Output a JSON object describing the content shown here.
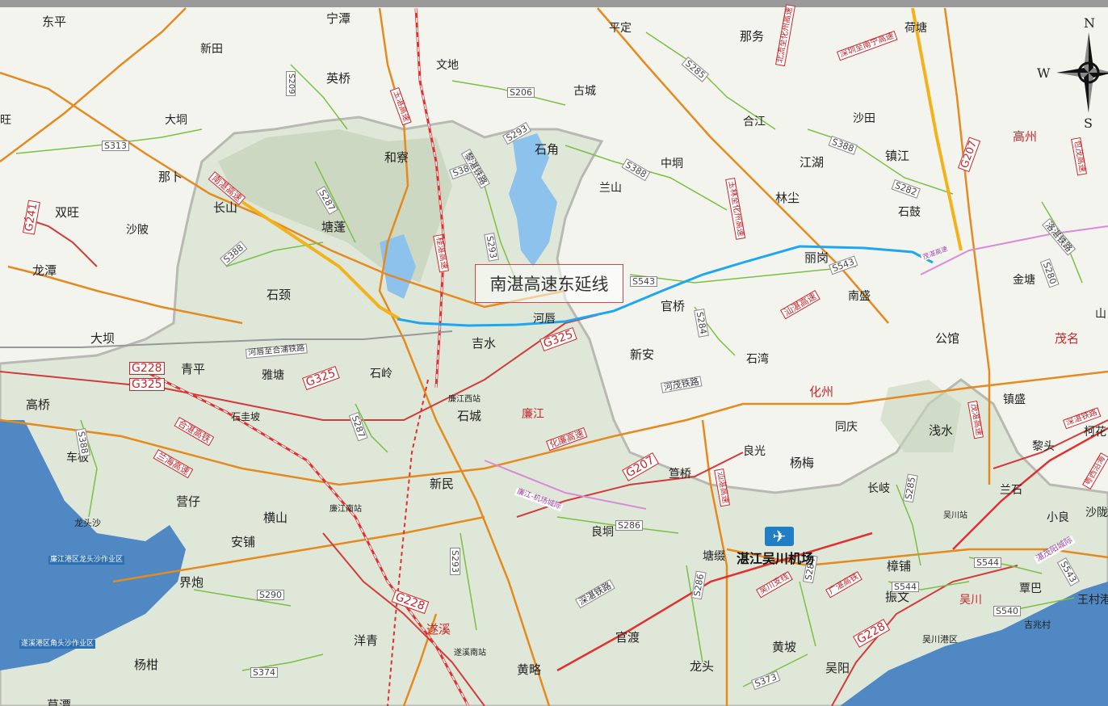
{
  "callout": "南湛高速东延线",
  "airport": {
    "name": "湛江吴川机场",
    "icon": "airplane-icon"
  },
  "compass": {
    "n": "N",
    "w": "W",
    "s": "S"
  },
  "colors": {
    "highway": "#e48a1e",
    "national_road": "#d23b3b",
    "provincial_road": "#7ac043",
    "railway": "#e03030",
    "extension_line": "#1ea6ee",
    "water": "#8cc2ec",
    "land": "#f4f4ef",
    "terrain": "#dfe7d8"
  },
  "places": [
    {
      "id": "dongping",
      "name": "东平"
    },
    {
      "id": "ningtan",
      "name": "宁潭"
    },
    {
      "id": "pingding",
      "name": "平定"
    },
    {
      "id": "nawu",
      "name": "那务"
    },
    {
      "id": "hetang",
      "name": "荷塘"
    },
    {
      "id": "xintian",
      "name": "新田"
    },
    {
      "id": "wendi",
      "name": "文地"
    },
    {
      "id": "yingqiao",
      "name": "英桥"
    },
    {
      "id": "guchen",
      "name": "古城"
    },
    {
      "id": "wang",
      "name": "旺"
    },
    {
      "id": "dakeng",
      "name": "大垌"
    },
    {
      "id": "hehe",
      "name": "合江"
    },
    {
      "id": "shatian",
      "name": "沙田"
    },
    {
      "id": "gaozhou",
      "name": "高州"
    },
    {
      "id": "hezhai",
      "name": "和寮"
    },
    {
      "id": "shijiao",
      "name": "石角"
    },
    {
      "id": "nabu",
      "name": "那卜"
    },
    {
      "id": "zhongjiong",
      "name": "中垌"
    },
    {
      "id": "jianghu",
      "name": "江湖"
    },
    {
      "id": "zhenjiang",
      "name": "镇江"
    },
    {
      "id": "lanshan",
      "name": "兰山"
    },
    {
      "id": "changshan",
      "name": "长山"
    },
    {
      "id": "shuangwang",
      "name": "双旺"
    },
    {
      "id": "linchen",
      "name": "林尘"
    },
    {
      "id": "shigu",
      "name": "石鼓"
    },
    {
      "id": "tangpeng",
      "name": "塘蓬"
    },
    {
      "id": "shapo",
      "name": "沙陂"
    },
    {
      "id": "longtan",
      "name": "龙潭"
    },
    {
      "id": "ligang",
      "name": "丽岗"
    },
    {
      "id": "jintang",
      "name": "金塘"
    },
    {
      "id": "shixu",
      "name": "石颈"
    },
    {
      "id": "nansheng",
      "name": "南盛"
    },
    {
      "id": "guanqiao",
      "name": "官桥"
    },
    {
      "id": "hechun",
      "name": "河唇"
    },
    {
      "id": "shan",
      "name": "山"
    },
    {
      "id": "daba",
      "name": "大坝"
    },
    {
      "id": "jishui",
      "name": "吉水"
    },
    {
      "id": "gongguan",
      "name": "公馆"
    },
    {
      "id": "maoming",
      "name": "茂名"
    },
    {
      "id": "qingping",
      "name": "青平"
    },
    {
      "id": "xinan",
      "name": "新安"
    },
    {
      "id": "shiwan",
      "name": "石湾"
    },
    {
      "id": "huazhou",
      "name": "化州"
    },
    {
      "id": "yatang",
      "name": "雅塘"
    },
    {
      "id": "shiling",
      "name": "石岭"
    },
    {
      "id": "gaoqiao",
      "name": "高桥"
    },
    {
      "id": "lianjiangxi",
      "name": "廉江西站"
    },
    {
      "id": "shigupo",
      "name": "石圭坡"
    },
    {
      "id": "shicheng",
      "name": "石城"
    },
    {
      "id": "lianjiang",
      "name": "廉江"
    },
    {
      "id": "zhensheng",
      "name": "镇盛"
    },
    {
      "id": "tongqing",
      "name": "同庆"
    },
    {
      "id": "qianshui",
      "name": "浅水"
    },
    {
      "id": "kehua",
      "name": "柯花"
    },
    {
      "id": "cheban",
      "name": "车板"
    },
    {
      "id": "liangguang",
      "name": "良光"
    },
    {
      "id": "shentou",
      "name": "黎头"
    },
    {
      "id": "xinmin",
      "name": "新民"
    },
    {
      "id": "yangmei",
      "name": "杨梅"
    },
    {
      "id": "dongqiao",
      "name": "笪桥"
    },
    {
      "id": "changqi",
      "name": "长岐"
    },
    {
      "id": "lanshi",
      "name": "兰石"
    },
    {
      "id": "yingzai",
      "name": "营仔"
    },
    {
      "id": "lianjiangnan",
      "name": "廉江南站"
    },
    {
      "id": "hengshan",
      "name": "横山"
    },
    {
      "id": "wuchuanzhan",
      "name": "吴川站"
    },
    {
      "id": "xiaoliang",
      "name": "小良"
    },
    {
      "id": "shaxi",
      "name": "沙陇"
    },
    {
      "id": "longtousha",
      "name": "龙头沙"
    },
    {
      "id": "liangdong",
      "name": "良垌"
    },
    {
      "id": "anpu",
      "name": "安铺"
    },
    {
      "id": "tangzhui",
      "name": "塘缀"
    },
    {
      "id": "zhangpu",
      "name": "樟铺"
    },
    {
      "id": "lianjianggang",
      "name": "廉江港区龙头沙作业区"
    },
    {
      "id": "jiepao",
      "name": "界炮"
    },
    {
      "id": "zhenwen",
      "name": "振文"
    },
    {
      "id": "wuchuan",
      "name": "吴川"
    },
    {
      "id": "qinba",
      "name": "覃巴"
    },
    {
      "id": "wangcun",
      "name": "王村港"
    },
    {
      "id": "suixi",
      "name": "遂溪"
    },
    {
      "id": "guandu",
      "name": "官渡"
    },
    {
      "id": "jizhaocun",
      "name": "吉兆村"
    },
    {
      "id": "yangqing",
      "name": "洋青"
    },
    {
      "id": "wuchuangang",
      "name": "吴川港区"
    },
    {
      "id": "suixigang",
      "name": "遂溪港区角头沙作业区"
    },
    {
      "id": "huangpo",
      "name": "黄坡"
    },
    {
      "id": "yanggan",
      "name": "杨柑"
    },
    {
      "id": "suixinan",
      "name": "遂溪南站"
    },
    {
      "id": "huanglue",
      "name": "黄略"
    },
    {
      "id": "longtou",
      "name": "龙头"
    },
    {
      "id": "wuyang",
      "name": "吴阳"
    },
    {
      "id": "caotan",
      "name": "草潭"
    }
  ],
  "roads": [
    {
      "id": "s313",
      "name": "S313"
    },
    {
      "id": "s209",
      "name": "S209"
    },
    {
      "id": "s206",
      "name": "S206"
    },
    {
      "id": "s285",
      "name": "S285"
    },
    {
      "id": "s293a",
      "name": "S293"
    },
    {
      "id": "s388a",
      "name": "S388"
    },
    {
      "id": "s287",
      "name": "S287"
    },
    {
      "id": "s388b",
      "name": "S388"
    },
    {
      "id": "s388c",
      "name": "S388"
    },
    {
      "id": "s282",
      "name": "S282"
    },
    {
      "id": "g207a",
      "name": "G207"
    },
    {
      "id": "g241",
      "name": "G241"
    },
    {
      "id": "s388d",
      "name": "S388"
    },
    {
      "id": "s293b",
      "name": "S293"
    },
    {
      "id": "s543a",
      "name": "S543"
    },
    {
      "id": "s543b",
      "name": "S543"
    },
    {
      "id": "s284a",
      "name": "S284"
    },
    {
      "id": "g325a",
      "name": "G325"
    },
    {
      "id": "g228a",
      "name": "G228"
    },
    {
      "id": "g325b",
      "name": "G325"
    },
    {
      "id": "g325c",
      "name": "G325"
    },
    {
      "id": "s280",
      "name": "S280"
    },
    {
      "id": "s287b",
      "name": "S287"
    },
    {
      "id": "s388e",
      "name": "S388"
    },
    {
      "id": "g207b",
      "name": "G207"
    },
    {
      "id": "s286a",
      "name": "S286"
    },
    {
      "id": "s285b",
      "name": "S285"
    },
    {
      "id": "s290",
      "name": "S290"
    },
    {
      "id": "s293c",
      "name": "S293"
    },
    {
      "id": "g228b",
      "name": "G228"
    },
    {
      "id": "s286b",
      "name": "S286"
    },
    {
      "id": "s284b",
      "name": "S284"
    },
    {
      "id": "s544a",
      "name": "S544"
    },
    {
      "id": "s544b",
      "name": "S544"
    },
    {
      "id": "s540",
      "name": "S540"
    },
    {
      "id": "s543c",
      "name": "S543"
    },
    {
      "id": "s374",
      "name": "S374"
    },
    {
      "id": "s373",
      "name": "S373"
    },
    {
      "id": "g228c",
      "name": "G228"
    }
  ],
  "route_labels": [
    {
      "id": "nanzhan",
      "name": "南湛高速"
    },
    {
      "id": "yuzhan",
      "name": "玉湛高速"
    },
    {
      "id": "lizhan_rail",
      "name": "黎湛铁路"
    },
    {
      "id": "shenzhen_nanning",
      "name": "深圳至南宁高速"
    },
    {
      "id": "beiliu",
      "name": "北流至化州高速"
    },
    {
      "id": "shenzhan_rail",
      "name": "深湛铁路"
    },
    {
      "id": "guizhan",
      "name": "桂湛高速"
    },
    {
      "id": "yulin_huazhou",
      "name": "玉林至化州高速"
    },
    {
      "id": "baomao",
      "name": "包茂高速"
    },
    {
      "id": "luogang",
      "name": "洛湛铁路"
    },
    {
      "id": "hemao_rail",
      "name": "河茂铁路"
    },
    {
      "id": "shantou_zhan",
      "name": "汕湛高速"
    },
    {
      "id": "hepu_rail",
      "name": "河唇至合浦铁路"
    },
    {
      "id": "mao_zhan",
      "name": "茂湛高速"
    },
    {
      "id": "hezhan_rail",
      "name": "合湛高铁"
    },
    {
      "id": "lanhai",
      "name": "兰海高速"
    },
    {
      "id": "hualian",
      "name": "化廉高速"
    },
    {
      "id": "lianjiang_airport",
      "name": "廉江-机场城际"
    },
    {
      "id": "maozhan_gaotie",
      "name": "茂湛高速"
    },
    {
      "id": "shanzhan2",
      "name": "汕湛高速"
    },
    {
      "id": "shenzhan_rail2",
      "name": "深湛铁路"
    },
    {
      "id": "wuchuan_branch",
      "name": "吴川支线"
    },
    {
      "id": "guangzhan",
      "name": "广湛高铁"
    },
    {
      "id": "zhanmao",
      "name": "湛茂阳城际"
    },
    {
      "id": "yuezhan",
      "name": "粤西沿海"
    }
  ]
}
